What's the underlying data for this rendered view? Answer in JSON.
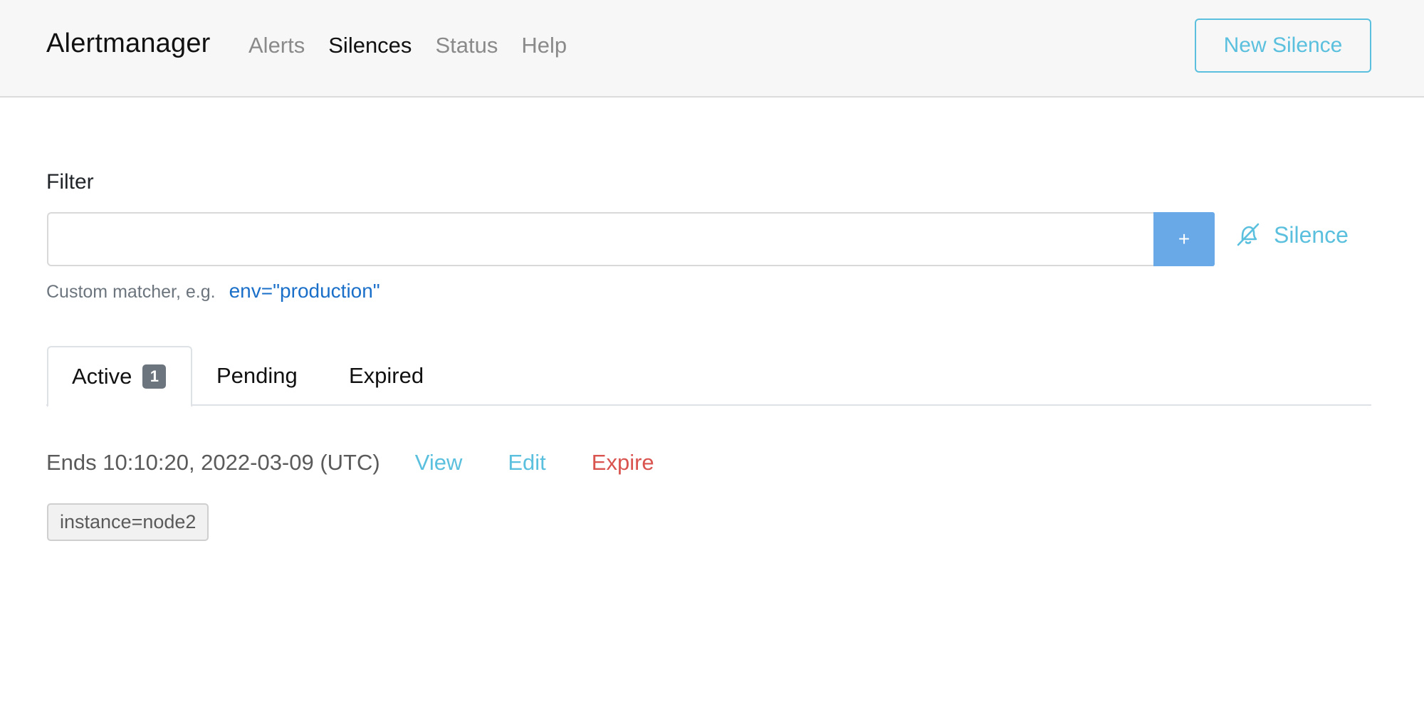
{
  "navbar": {
    "brand": "Alertmanager",
    "links": [
      {
        "label": "Alerts",
        "active": false
      },
      {
        "label": "Silences",
        "active": true
      },
      {
        "label": "Status",
        "active": false
      },
      {
        "label": "Help",
        "active": false
      }
    ],
    "new_silence_label": "New Silence"
  },
  "filter": {
    "label": "Filter",
    "input_value": "",
    "add_button_label": "+",
    "silence_link_label": "Silence",
    "silence_icon": "bell-slash-icon",
    "hint_text": "Custom matcher, e.g.",
    "hint_example": "env=\"production\""
  },
  "tabs": {
    "active": {
      "label": "Active",
      "count": "1"
    },
    "pending": {
      "label": "Pending"
    },
    "expired": {
      "label": "Expired"
    }
  },
  "silences": [
    {
      "ends": "Ends 10:10:20, 2022-03-09 (UTC)",
      "view_label": "View",
      "edit_label": "Edit",
      "expire_label": "Expire",
      "matchers": [
        "instance=node2"
      ]
    }
  ],
  "colors": {
    "navbar_bg": "#f7f7f7",
    "info": "#5bc0de",
    "danger": "#d9534f",
    "primary_button": "#6aa9e8",
    "link": "#1a6fc9",
    "badge": "#6c757d"
  }
}
